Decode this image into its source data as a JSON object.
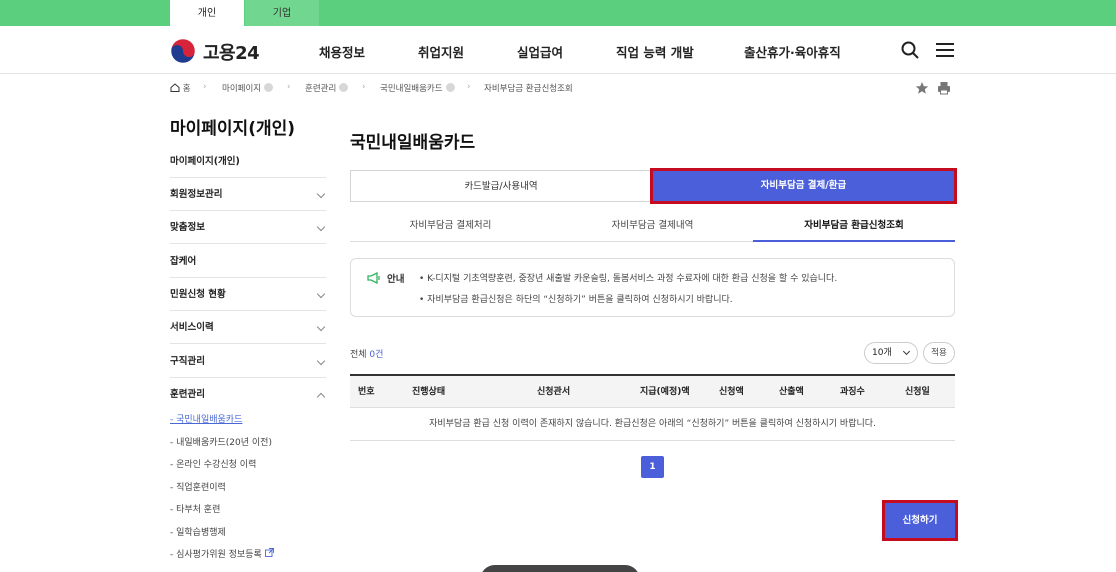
{
  "top_tabs": {
    "personal": "개인",
    "business": "기업"
  },
  "header": {
    "logo_text": "고용24",
    "nav": [
      "채용정보",
      "취업지원",
      "실업급여",
      "직업 능력 개발",
      "출산휴가·육아휴직"
    ],
    "search_icon": "search-icon",
    "menu_icon": "hamburger-menu-icon"
  },
  "breadcrumb": [
    "홈",
    "마이페이지",
    "훈련관리",
    "국민내일배움카드",
    "자비부담금 환급신청조회"
  ],
  "sidebar": {
    "title": "마이페이지(개인)",
    "items": [
      "마이페이지(개인)",
      "회원정보관리",
      "맞춤정보",
      "잡케어",
      "민원신청 현황",
      "서비스이력",
      "구직관리",
      "훈련관리"
    ],
    "sub_items": [
      "- 국민내일배움카드",
      "- 내일배움카드(20년 이전)",
      "- 온라인 수강신청 이력",
      "- 직업훈련이력",
      "- 타부처 훈련",
      "- 일학습병행제",
      "- 심사평가위원 정보등록"
    ]
  },
  "main": {
    "title": "국민내일배움카드",
    "segments": [
      "카드발급/사용내역",
      "자비부담금 결제/환급"
    ],
    "subtabs": [
      "자비부담금 결제처리",
      "자비부담금 결제내역",
      "자비부담금 환급신청조회"
    ],
    "notice": {
      "label": "안내",
      "lines": [
        "• K-디지털 기초역량훈련, 중장년 새출발 카운슬링, 돌봄서비스 과정 수료자에 대한 환급 신청을 할 수 있습니다.",
        "• 자비부담금 환급신청은 하단의 “신청하기” 버튼을 클릭하여 신청하시기 바랍니다."
      ]
    },
    "total_prefix": "전체 ",
    "total_count": "0건",
    "page_size": "10개",
    "apply_filter": "적용",
    "table": {
      "headers": [
        "번호",
        "진행상태",
        "신청관서",
        "지급(예정)액",
        "신청액",
        "산출액",
        "과징수",
        "신청일"
      ],
      "empty_message": "자비부담금 환급 신청 이력이 존재하지 않습니다. 환급신청은 아래의 “신청하기” 버튼을 클릭하여 신청하시기 바랍니다."
    },
    "pagination": [
      "1"
    ],
    "submit_label": "신청하기"
  },
  "colors": {
    "brand_green": "#5ccf7f",
    "accent_blue": "#4a5fd9",
    "highlight_red": "#c40b1f"
  }
}
